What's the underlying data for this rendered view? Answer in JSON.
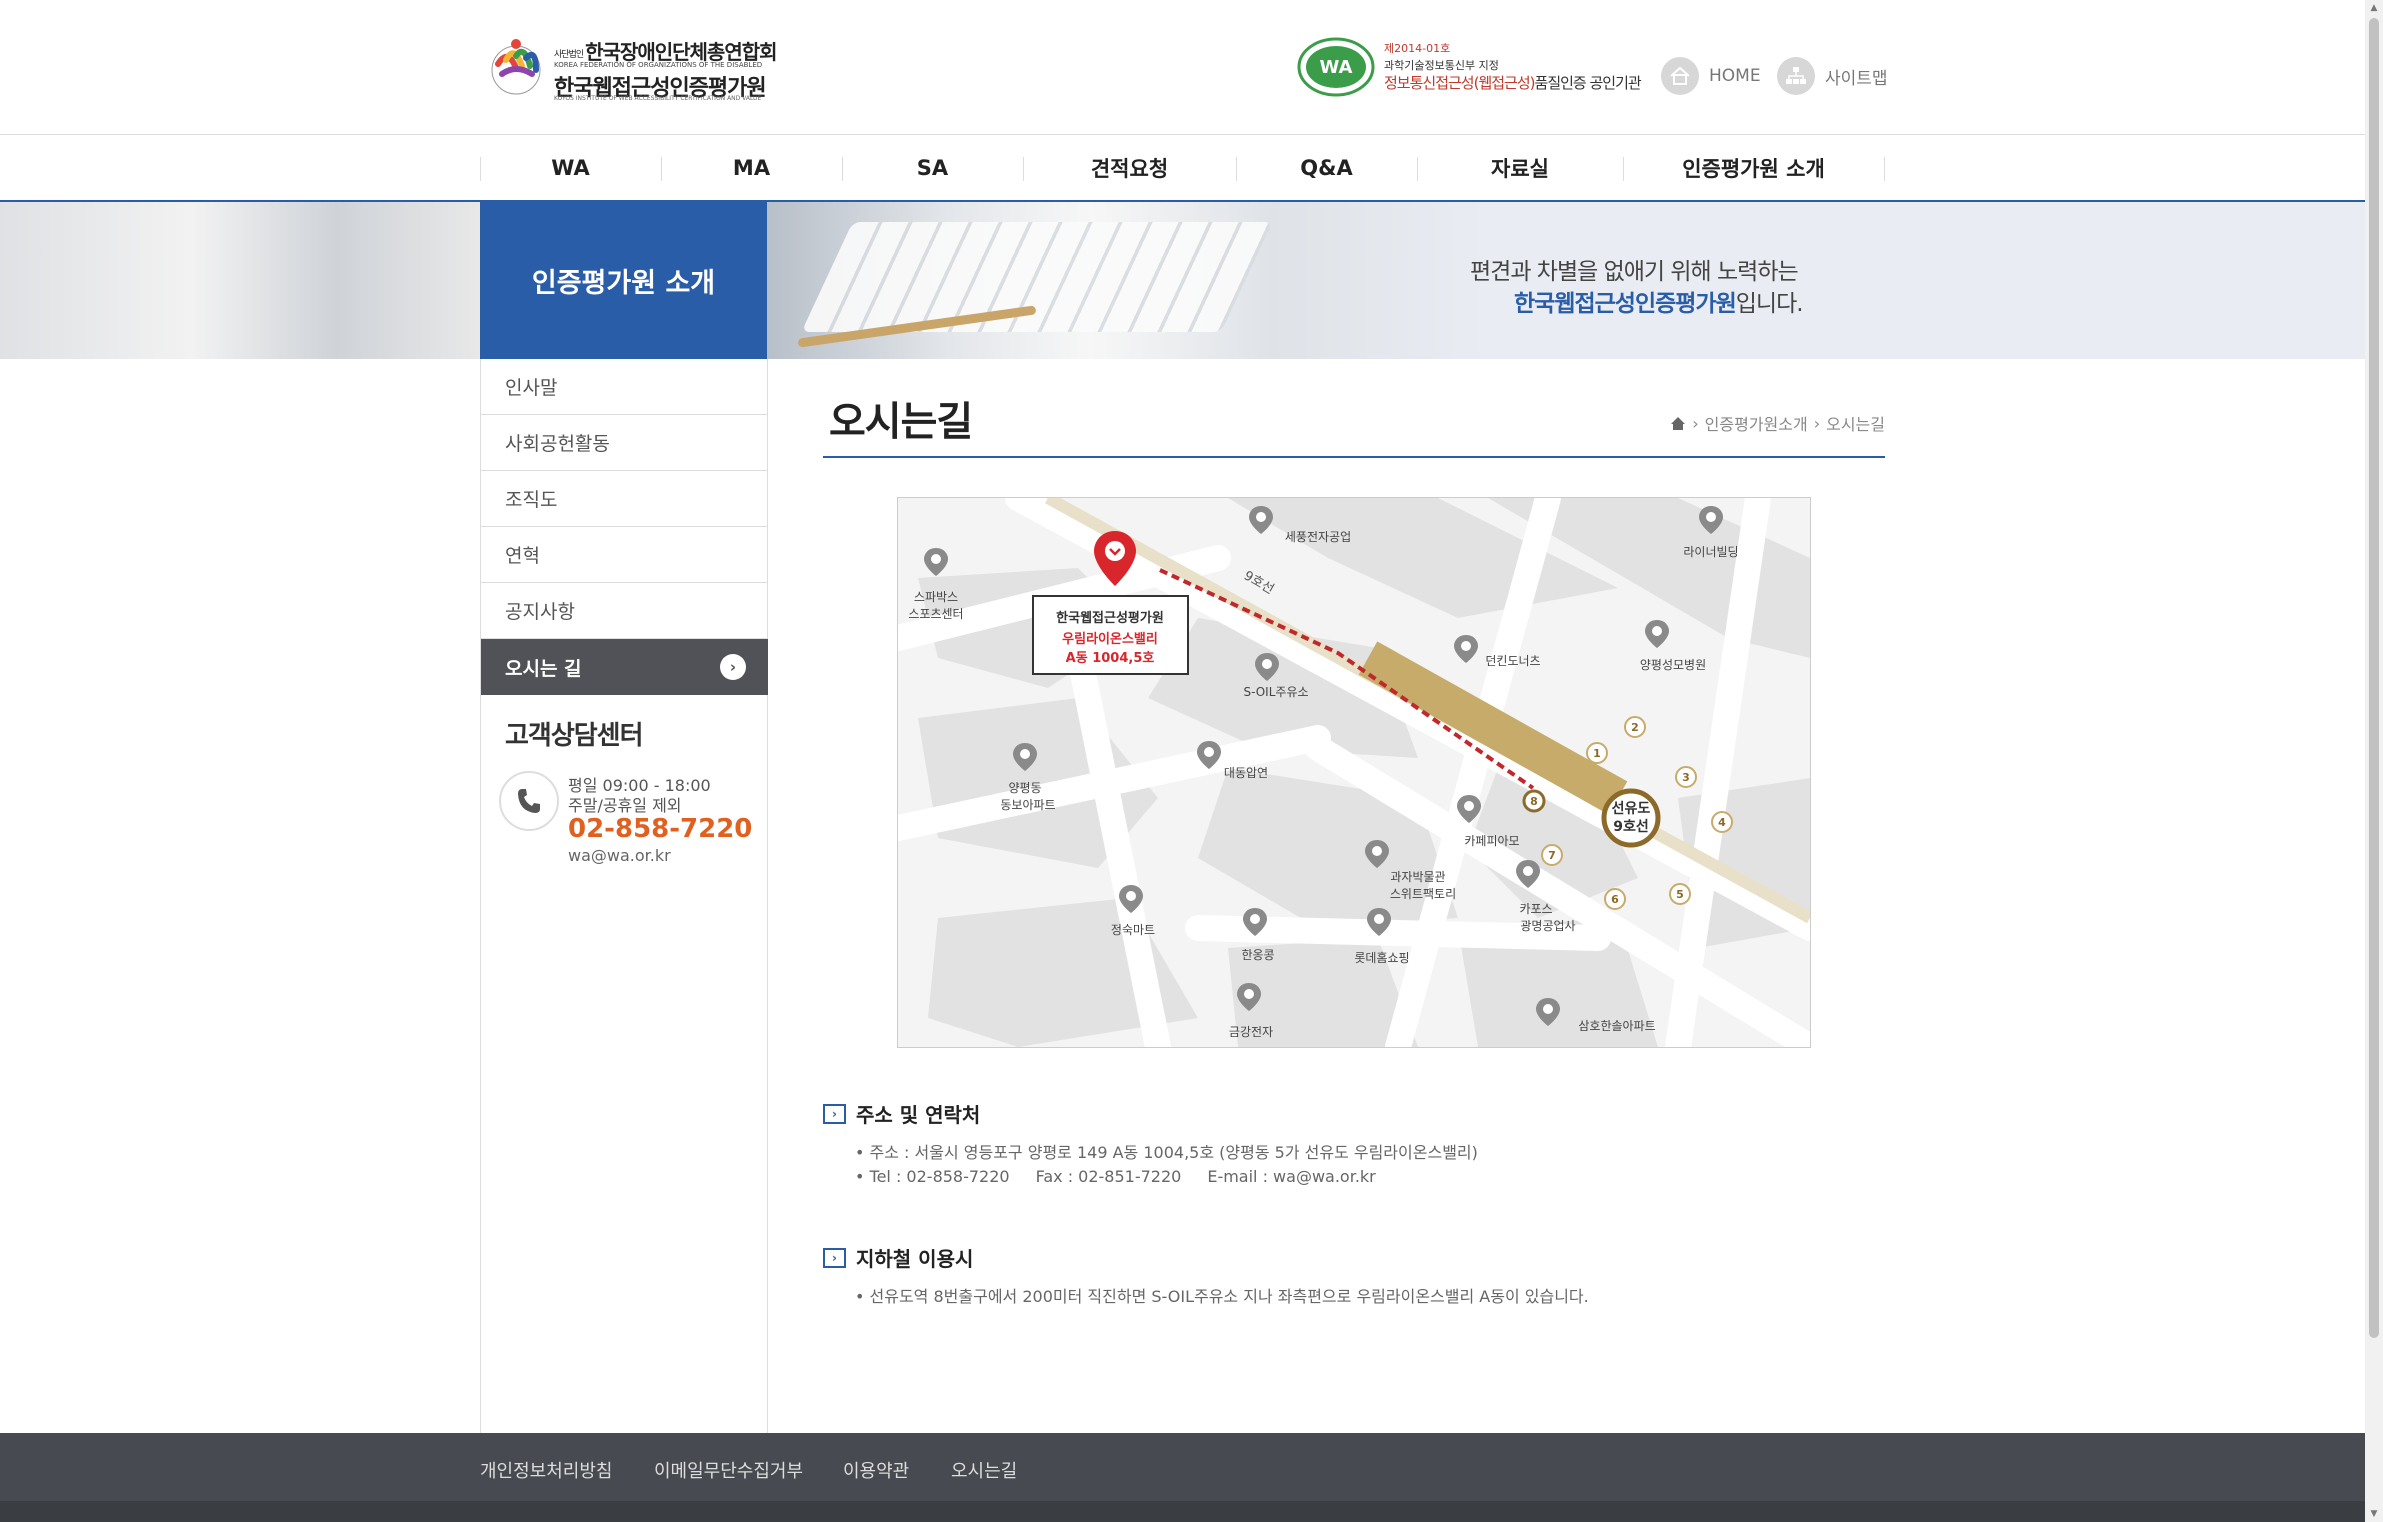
{
  "header": {
    "logo": {
      "org_tiny": "사단법인",
      "org_name": "한국장애인단체총연합회",
      "org_en": "KOREA FEDERATION OF ORGANIZATIONS OF THE DISABLED",
      "institute_name": "한국웹접근성인증평가원",
      "institute_en": "KOYOS INSTITUTE OF WEB ACCESSIBILITY CERTIFICATION AND VALUE"
    },
    "cert": {
      "badge": "WA",
      "line1": "제2014-01호",
      "line2": "과학기술정보통신부 지정",
      "line3_red": "정보통신접근성(웹접근성)",
      "line3_rest": "품질인증 공인기관"
    },
    "home_label": "HOME",
    "sitemap_label": "사이트맵"
  },
  "gnb": [
    "WA",
    "MA",
    "SA",
    "견적요청",
    "Q&A",
    "자료실",
    "인증평가원 소개"
  ],
  "visual": {
    "section_title": "인증평가원 소개",
    "slogan_line1": "편견과 차별을 없애기 위해 노력하는",
    "slogan_line2_strong": "한국웹접근성인증평가원",
    "slogan_line2_rest": "입니다."
  },
  "lnb": {
    "items": [
      "인사말",
      "사회공헌활동",
      "조직도",
      "연혁",
      "공지사항",
      "오시는 길"
    ],
    "active_index": 5,
    "cs_title": "고객상담센터",
    "cs_hours1": "평일 09:00 - 18:00",
    "cs_hours2": "주말/공휴일 제외",
    "cs_phone": "02-858-7220",
    "cs_email": "wa@wa.or.kr"
  },
  "content": {
    "page_title": "오시는길",
    "breadcrumb": [
      "인증평가원소개",
      "오시는길"
    ]
  },
  "map": {
    "rail_label": "9호선",
    "station_name": "선유도",
    "station_line": "9호선",
    "target_name": "한국웹접근성평가원",
    "target_building": "우림라이온스밸리",
    "target_unit": "A동 1004,5호",
    "exits": [
      "1",
      "2",
      "3",
      "4",
      "5",
      "6",
      "7",
      "8"
    ],
    "landmarks": {
      "sejong": "세풍전자공업",
      "rainer": "라이너빌딩",
      "sparks1": "스파박스",
      "sparks2": "스포츠센터",
      "dunkin": "던킨도너츠",
      "hospital": "양평성모병원",
      "soil": "S-OIL주유소",
      "daedong": "대동압연",
      "apt1": "양평동",
      "apt2": "동보아파트",
      "cafe": "카페피아모",
      "museum1": "과자박물관",
      "museum2": "스위트팩토리",
      "caps1": "카포스",
      "caps2": "광명공업사",
      "mart": "정숙마트",
      "hanok": "한옹콩",
      "lotte": "롯데홈쇼핑",
      "geumgang": "금강전자",
      "samho": "삼호한솔아파트"
    }
  },
  "address_section": {
    "title": "주소 및 연락처",
    "address": "• 주소 : 서울시 영등포구 양평로 149 A동 1004,5호 (양평동 5가 선유도 우림라이온스밸리)",
    "tel": "• Tel : 02-858-7220",
    "fax": "Fax : 02-851-7220",
    "email": "E-mail : wa@wa.or.kr"
  },
  "subway_section": {
    "title": "지하철 이용시",
    "desc": "• 선유도역 8번출구에서 200미터 직진하면 S-OIL주유소 지나 좌측편으로 우림라이온스밸리 A동이 있습니다."
  },
  "footer": [
    "개인정보처리방침",
    "이메일무단수집거부",
    "이용약관",
    "오시는길"
  ],
  "colors": {
    "brand_blue": "#2a5da8",
    "phone_orange": "#e06020",
    "footer_bg": "#474a50",
    "marker_red": "#d9262c",
    "rail_gold": "#c7ab6a"
  }
}
